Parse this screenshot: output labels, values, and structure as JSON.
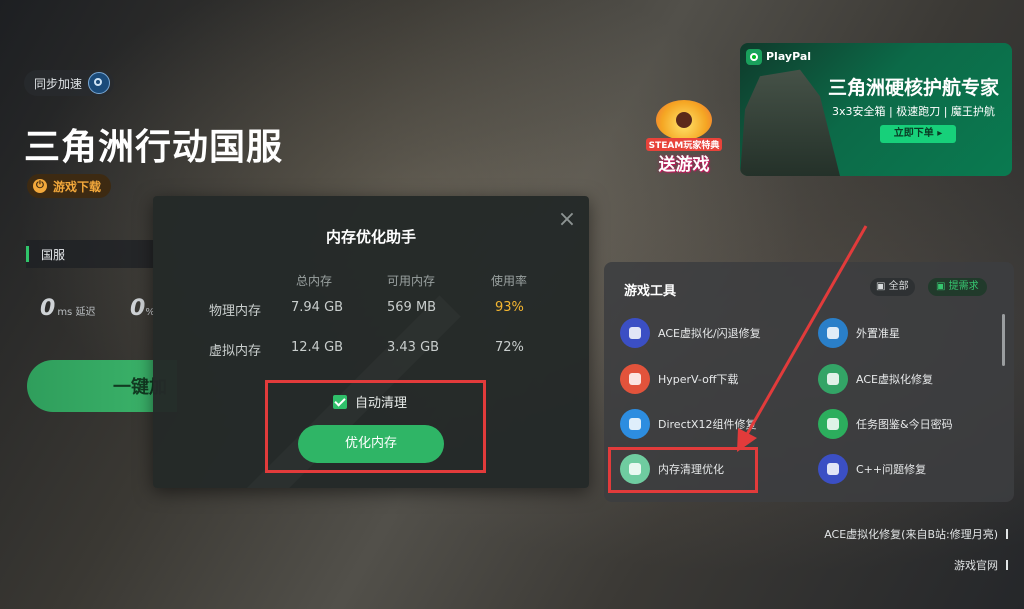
{
  "header": {
    "sync_label": "同步加速",
    "game_title": "三角洲行动国服",
    "download_label": "游戏下载"
  },
  "server": {
    "region_label": "国服",
    "latency_value": "0",
    "latency_unit": "ms 延迟",
    "loss_value": "0",
    "loss_unit": "%",
    "accelerate_label": "一键加"
  },
  "modal": {
    "title": "内存优化助手",
    "columns": [
      "总内存",
      "可用内存",
      "使用率"
    ],
    "rows": [
      {
        "label": "物理内存",
        "total": "7.94 GB",
        "available": "569 MB",
        "usage": "93%"
      },
      {
        "label": "虚拟内存",
        "total": "12.4 GB",
        "available": "3.43 GB",
        "usage": "72%"
      }
    ],
    "auto_clean_label": "自动清理",
    "auto_clean_checked": true,
    "optimize_button": "优化内存",
    "usage_warning_color": "#f5b731"
  },
  "sticker": {
    "line1": "STEAM玩家特典",
    "line2": "送游戏"
  },
  "banner": {
    "brand": "PlayPal",
    "headline": "三角洲硬核护航专家",
    "subline": "3x3安全箱 | 极速跑刀 | 魔王护航",
    "cta": "立即下单 ▸"
  },
  "tools": {
    "title": "游戏工具",
    "all_label": "全部",
    "request_label": "提需求",
    "items": [
      {
        "label": "ACE虚拟化/闪退修复",
        "icon": "wrench-icon",
        "color": "#3b4fc4"
      },
      {
        "label": "外置准星",
        "icon": "crosshair-icon",
        "color": "#2a7fc9"
      },
      {
        "label": "HyperV-off下载",
        "icon": "hyperv-icon",
        "color": "#e2533b"
      },
      {
        "label": "ACE虚拟化修复",
        "icon": "document-icon",
        "color": "#33a466"
      },
      {
        "label": "DirectX12组件修复",
        "icon": "directx-icon",
        "color": "#2d8de0"
      },
      {
        "label": "任务图鉴&今日密码",
        "icon": "delta-icon",
        "color": "#2cae5d"
      },
      {
        "label": "内存清理优化",
        "icon": "memory-icon",
        "color": "#6fcca0"
      },
      {
        "label": "C++问题修复",
        "icon": "wrench-icon",
        "color": "#3b4fc4"
      }
    ]
  },
  "links": {
    "ace_fix": "ACE虚拟化修复(来自B站:修理月亮)",
    "official_site": "游戏官网"
  },
  "colors": {
    "accent": "#2fb566",
    "highlight": "#e23b3b"
  }
}
